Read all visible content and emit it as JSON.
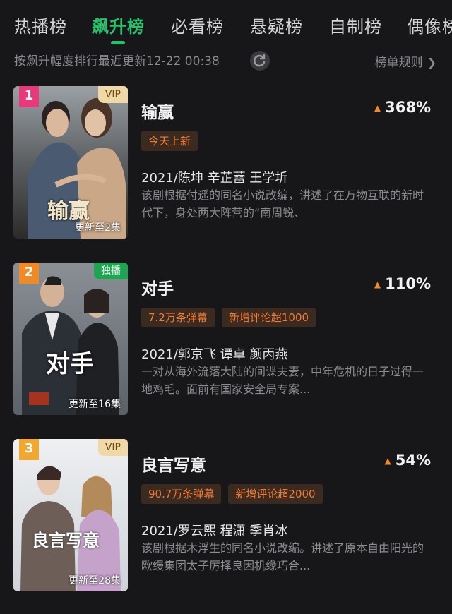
{
  "tabs": [
    {
      "label": "热播榜"
    },
    {
      "label": "飙升榜"
    },
    {
      "label": "必看榜"
    },
    {
      "label": "悬疑榜"
    },
    {
      "label": "自制榜"
    },
    {
      "label": "偶像榜"
    }
  ],
  "subtitle": "按飙升幅度排行最近更新12-22 00:38",
  "rules_label": "榜单规则",
  "colors": {
    "accent": "#25c26b",
    "rise_arrow": "#f08a25",
    "pill_text": "#f07b37"
  },
  "items": [
    {
      "rank": "1",
      "rank_color": "#e8397a",
      "tag": "VIP",
      "update": "更新至2集",
      "poster_text": "输赢",
      "title": "输赢",
      "rise": "368%",
      "tags": [
        "今天上新"
      ],
      "meta": "2021/陈坤 辛芷蕾 王学圻",
      "desc": "该剧根据付遥的同名小说改编，讲述了在万物互联的新时代下，身处两大阵营的“南周锐、"
    },
    {
      "rank": "2",
      "rank_color": "#f08a25",
      "tag": "独播",
      "update": "更新至16集",
      "poster_text": "对手",
      "title": "对手",
      "rise": "110%",
      "tags": [
        "7.2万条弹幕",
        "新增评论超1000"
      ],
      "meta": "2021/郭京飞 谭卓 颜丙燕",
      "desc": "一对从海外流落大陆的间谍夫妻，中年危机的日子过得一地鸡毛。面前有国家安全局专案..."
    },
    {
      "rank": "3",
      "rank_color": "#f0a830",
      "tag": "VIP",
      "update": "更新至28集",
      "poster_text": "良言写意",
      "title": "良言写意",
      "rise": "54%",
      "tags": [
        "90.7万条弹幕",
        "新增评论超2000"
      ],
      "meta": "2021/罗云熙 程潇 季肖冰",
      "desc": "该剧根据木浮生的同名小说改编。讲述了原本自由阳光的欧缦集团太子厉择良因机缘巧合..."
    }
  ]
}
